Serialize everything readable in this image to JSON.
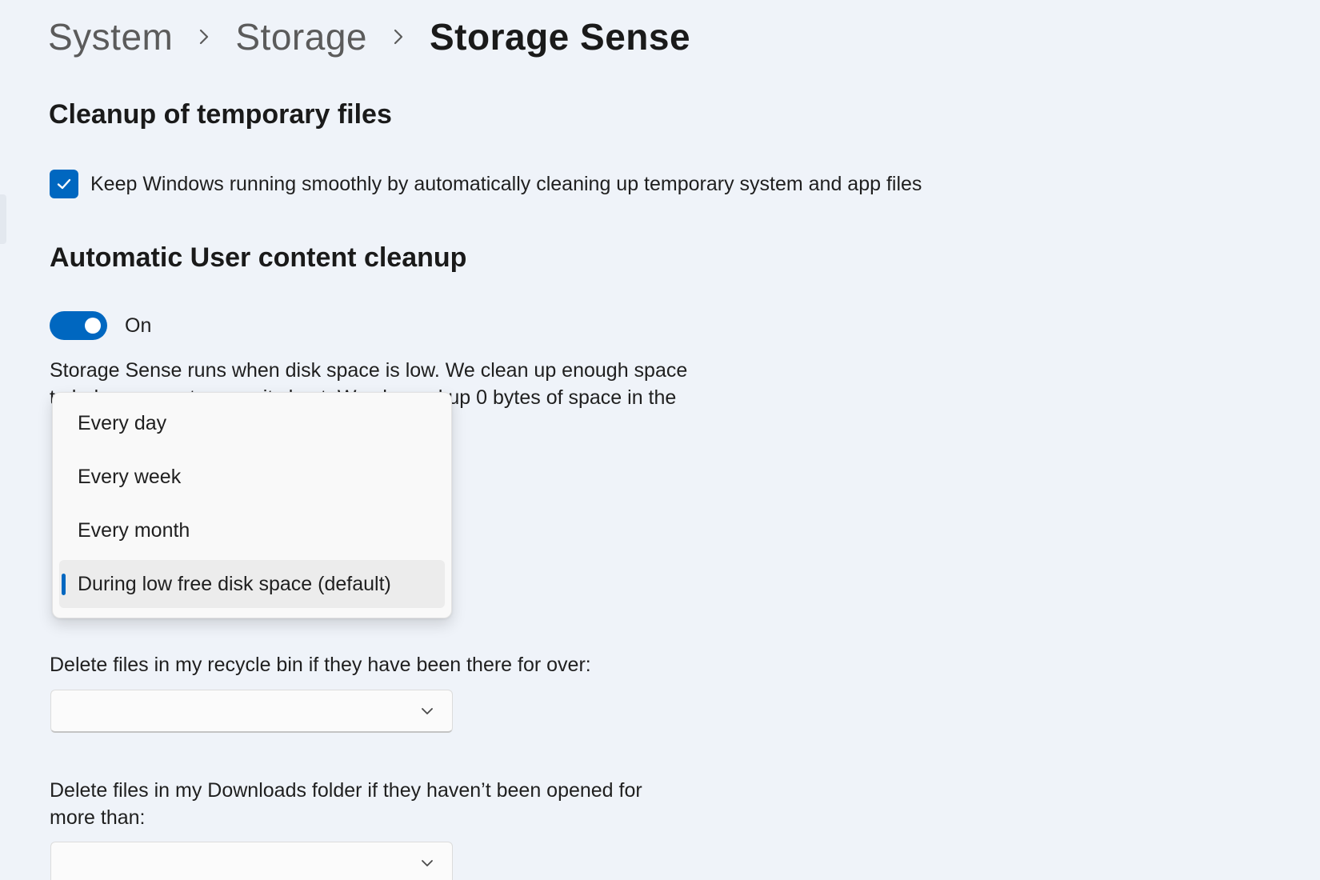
{
  "breadcrumb": {
    "items": [
      "System",
      "Storage"
    ],
    "current": "Storage Sense"
  },
  "temp_files": {
    "heading": "Cleanup of temporary files",
    "checkbox_label": "Keep Windows running smoothly by automatically cleaning up temporary system and app files",
    "checked": true
  },
  "user_content": {
    "heading": "Automatic User content cleanup",
    "toggle_state": "On",
    "description": "Storage Sense runs when disk space is low. We clean up enough space to help your system run its best. We cleaned up 0 bytes of space in the"
  },
  "run_schedule_dropdown": {
    "options": [
      "Every day",
      "Every week",
      "Every month",
      "During low free disk space (default)"
    ],
    "selected": "During low free disk space (default)"
  },
  "recycle_bin": {
    "label": "Delete files in my recycle bin if they have been there for over:",
    "value": ""
  },
  "downloads": {
    "label": "Delete files in my Downloads folder if they haven’t been opened for more than:",
    "value": ""
  },
  "colors": {
    "accent": "#0067c0",
    "background": "#eff3f9"
  }
}
